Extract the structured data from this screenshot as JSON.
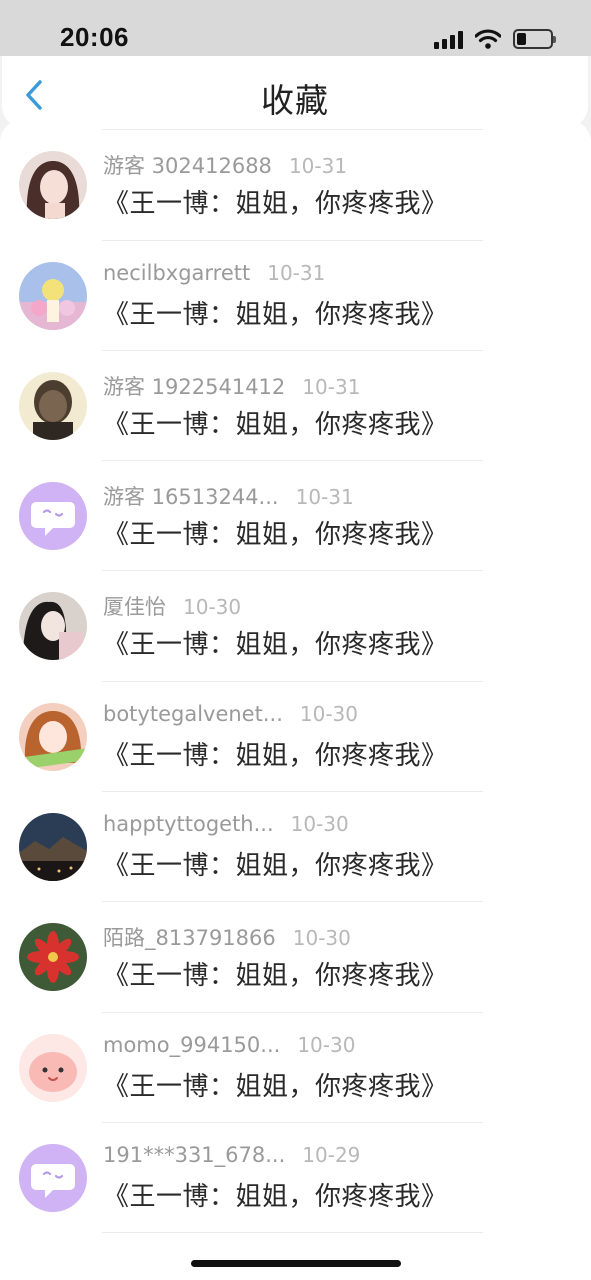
{
  "status_bar": {
    "time": "20:06"
  },
  "header": {
    "title": "收藏",
    "back_icon": "chevron-left-icon"
  },
  "colors": {
    "accent": "#3a9bd9",
    "bot_avatar": "#cfb3f4"
  },
  "favorites": [
    {
      "user": "",
      "date": "",
      "title": "《王一博：姐姐，你疼疼我》",
      "avatar": "bot"
    },
    {
      "user": "游客 302412688",
      "date": "10-31",
      "title": "《王一博：姐姐，你疼疼我》",
      "avatar": "photo-girl"
    },
    {
      "user": "necilbxgarrett",
      "date": "10-31",
      "title": "《王一博：姐姐，你疼疼我》",
      "avatar": "photo-flowers"
    },
    {
      "user": "游客 1922541412",
      "date": "10-31",
      "title": "《王一博：姐姐，你疼疼我》",
      "avatar": "photo-man"
    },
    {
      "user": "游客 16513244...",
      "date": "10-31",
      "title": "《王一博：姐姐，你疼疼我》",
      "avatar": "bot"
    },
    {
      "user": "厦佳怡",
      "date": "10-30",
      "title": "《王一博：姐姐，你疼疼我》",
      "avatar": "photo-girl-bw"
    },
    {
      "user": "botytegalvenet...",
      "date": "10-30",
      "title": "《王一博：姐姐，你疼疼我》",
      "avatar": "photo-anime"
    },
    {
      "user": "happtyttogeth...",
      "date": "10-30",
      "title": "《王一博：姐姐，你疼疼我》",
      "avatar": "photo-landscape"
    },
    {
      "user": "陌路_813791866",
      "date": "10-30",
      "title": "《王一博：姐姐，你疼疼我》",
      "avatar": "photo-red-flower"
    },
    {
      "user": "momo_994150...",
      "date": "10-30",
      "title": "《王一博：姐姐，你疼疼我》",
      "avatar": "cartoon-pink"
    },
    {
      "user": "191***331_678...",
      "date": "10-29",
      "title": "《王一博：姐姐，你疼疼我》",
      "avatar": "bot"
    }
  ]
}
